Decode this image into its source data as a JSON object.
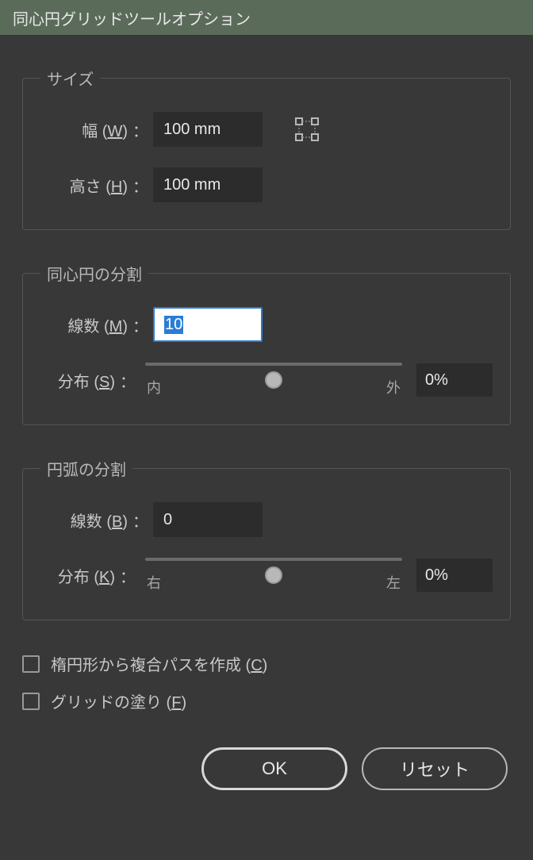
{
  "title": "同心円グリッドツールオプション",
  "size": {
    "legend": "サイズ",
    "width_label_pre": "幅 (",
    "width_hotkey": "W",
    "width_label_post": ")",
    "width_value": "100 mm",
    "height_label_pre": "高さ (",
    "height_hotkey": "H",
    "height_label_post": ")",
    "height_value": "100 mm"
  },
  "concentric": {
    "legend": "同心円の分割",
    "count_label_pre": "線数 (",
    "count_hotkey": "M",
    "count_label_post": ")",
    "count_value": "10",
    "skew_label_pre": "分布 (",
    "skew_hotkey": "S",
    "skew_label_post": ")",
    "skew_value": "0%",
    "skew_left": "内",
    "skew_right": "外"
  },
  "radial": {
    "legend": "円弧の分割",
    "count_label_pre": "線数 (",
    "count_hotkey": "B",
    "count_label_post": ")",
    "count_value": "0",
    "skew_label_pre": "分布 (",
    "skew_hotkey": "K",
    "skew_label_post": ")",
    "skew_value": "0%",
    "skew_left": "右",
    "skew_right": "左"
  },
  "compound_label_pre": "楕円形から複合パスを作成 (",
  "compound_hotkey": "C",
  "compound_label_post": ")",
  "fill_label_pre": "グリッドの塗り (",
  "fill_hotkey": "F",
  "fill_label_post": ")",
  "ok_label": "OK",
  "reset_label": "リセット"
}
